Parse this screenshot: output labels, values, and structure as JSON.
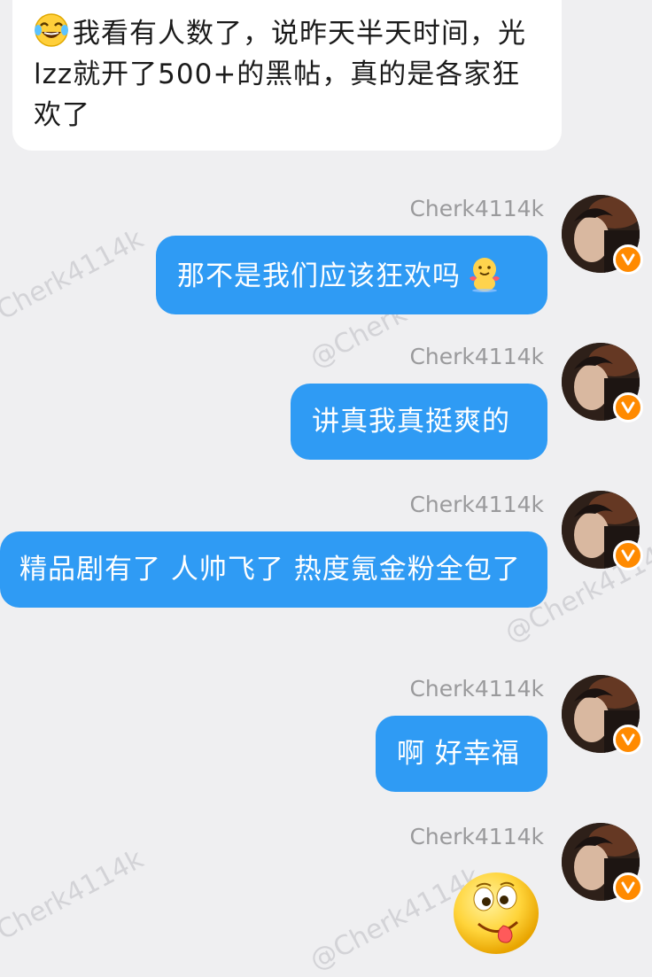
{
  "incoming": {
    "text": "我看有人数了，说昨天半天时间，光lzz就开了500+的黑帖，真的是各家狂欢了",
    "emoji": "laugh-cry-emoji"
  },
  "messages": [
    {
      "sender": "Cherk4114k",
      "text": "那不是我们应该狂欢吗",
      "emoji": "hug-emoji"
    },
    {
      "sender": "Cherk4114k",
      "text": "讲真我真挺爽的"
    },
    {
      "sender": "Cherk4114k",
      "text": "精品剧有了 人帅飞了 热度氪金粉全包了"
    },
    {
      "sender": "Cherk4114k",
      "text": "啊 好幸福"
    },
    {
      "sender": "Cherk4114k",
      "sticker": "tongue-out-face-sticker"
    }
  ],
  "watermark": "@Cherk4114k",
  "colors": {
    "background": "#efeff1",
    "bubble_out": "#2f9bf4",
    "bubble_in": "#ffffff",
    "verify_badge": "#ff8a00"
  }
}
